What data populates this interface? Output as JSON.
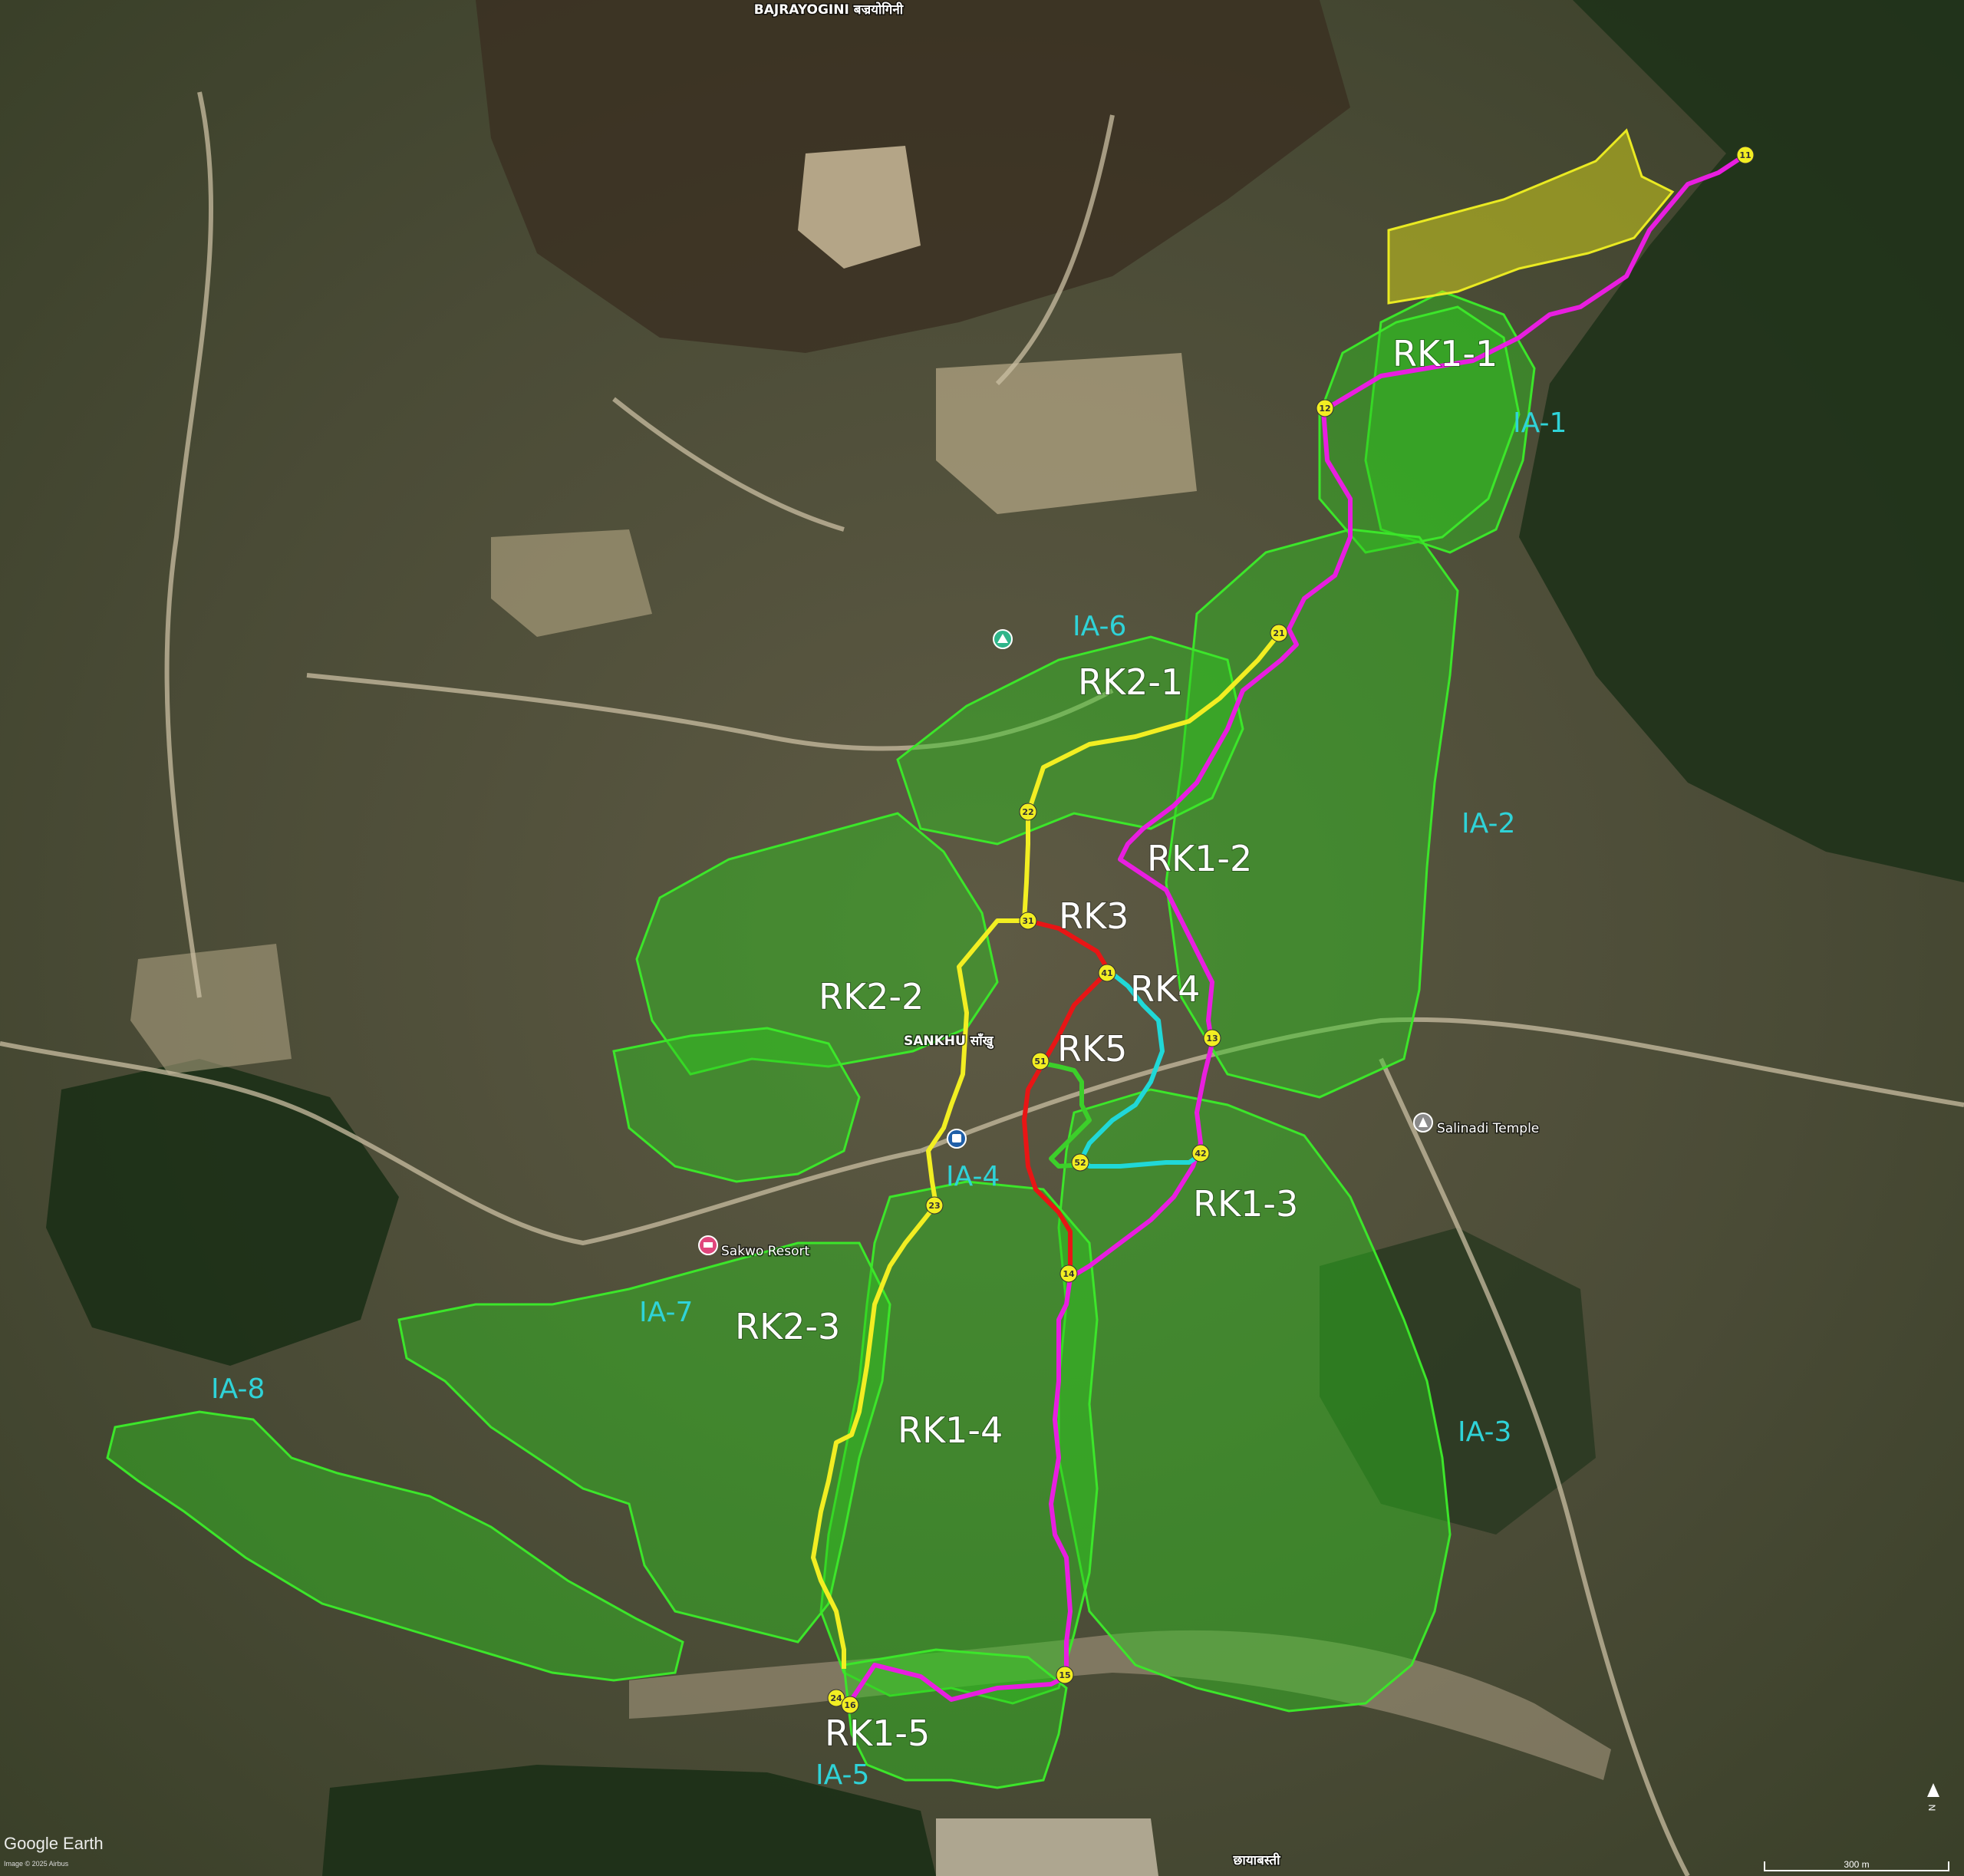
{
  "map": {
    "place_labels": {
      "bajrayogini": "BAJRAYOGINI बज्रयोगिनी",
      "sankhu": "SANKHU साँखु",
      "chhayabasti": "छायाबस्ती",
      "salinadi": "Salinadi Temple",
      "sakwo": "Sakwo Resort"
    },
    "route_labels": {
      "rk1_1": "RK1-1",
      "rk1_2": "RK1-2",
      "rk1_3": "RK1-3",
      "rk1_4": "RK1-4",
      "rk1_5": "RK1-5",
      "rk2_1": "RK2-1",
      "rk2_2": "RK2-2",
      "rk2_3": "RK2-3",
      "rk3": "RK3",
      "rk4": "RK4",
      "rk5": "RK5"
    },
    "area_labels": {
      "ia1": "IA-1",
      "ia2": "IA-2",
      "ia3": "IA-3",
      "ia4": "IA-4",
      "ia5": "IA-5",
      "ia6": "IA-6",
      "ia7": "IA-7",
      "ia8": "IA-8"
    },
    "nodes": {
      "n11": "11",
      "n12": "12",
      "n13": "13",
      "n14": "14",
      "n15": "15",
      "n16": "16",
      "n21": "21",
      "n22": "22",
      "n23": "23",
      "n24": "24",
      "n31": "31",
      "n41": "41",
      "n42": "42",
      "n51": "51",
      "n52": "52"
    },
    "route_colors": {
      "rk1": "#e81ee0",
      "rk2": "#f2ee22",
      "rk3": "#e81515",
      "rk4": "#20d8d8",
      "rk5": "#3ccf2a"
    },
    "irrigation_area_color": "#2fc81e",
    "highlight_area_color": "#d9d91a",
    "node_color": "#f2ee22",
    "attribution": {
      "brand": "Google Earth",
      "imagery": "Image © 2025 Airbus",
      "scale": "300 m",
      "north": "N"
    }
  }
}
